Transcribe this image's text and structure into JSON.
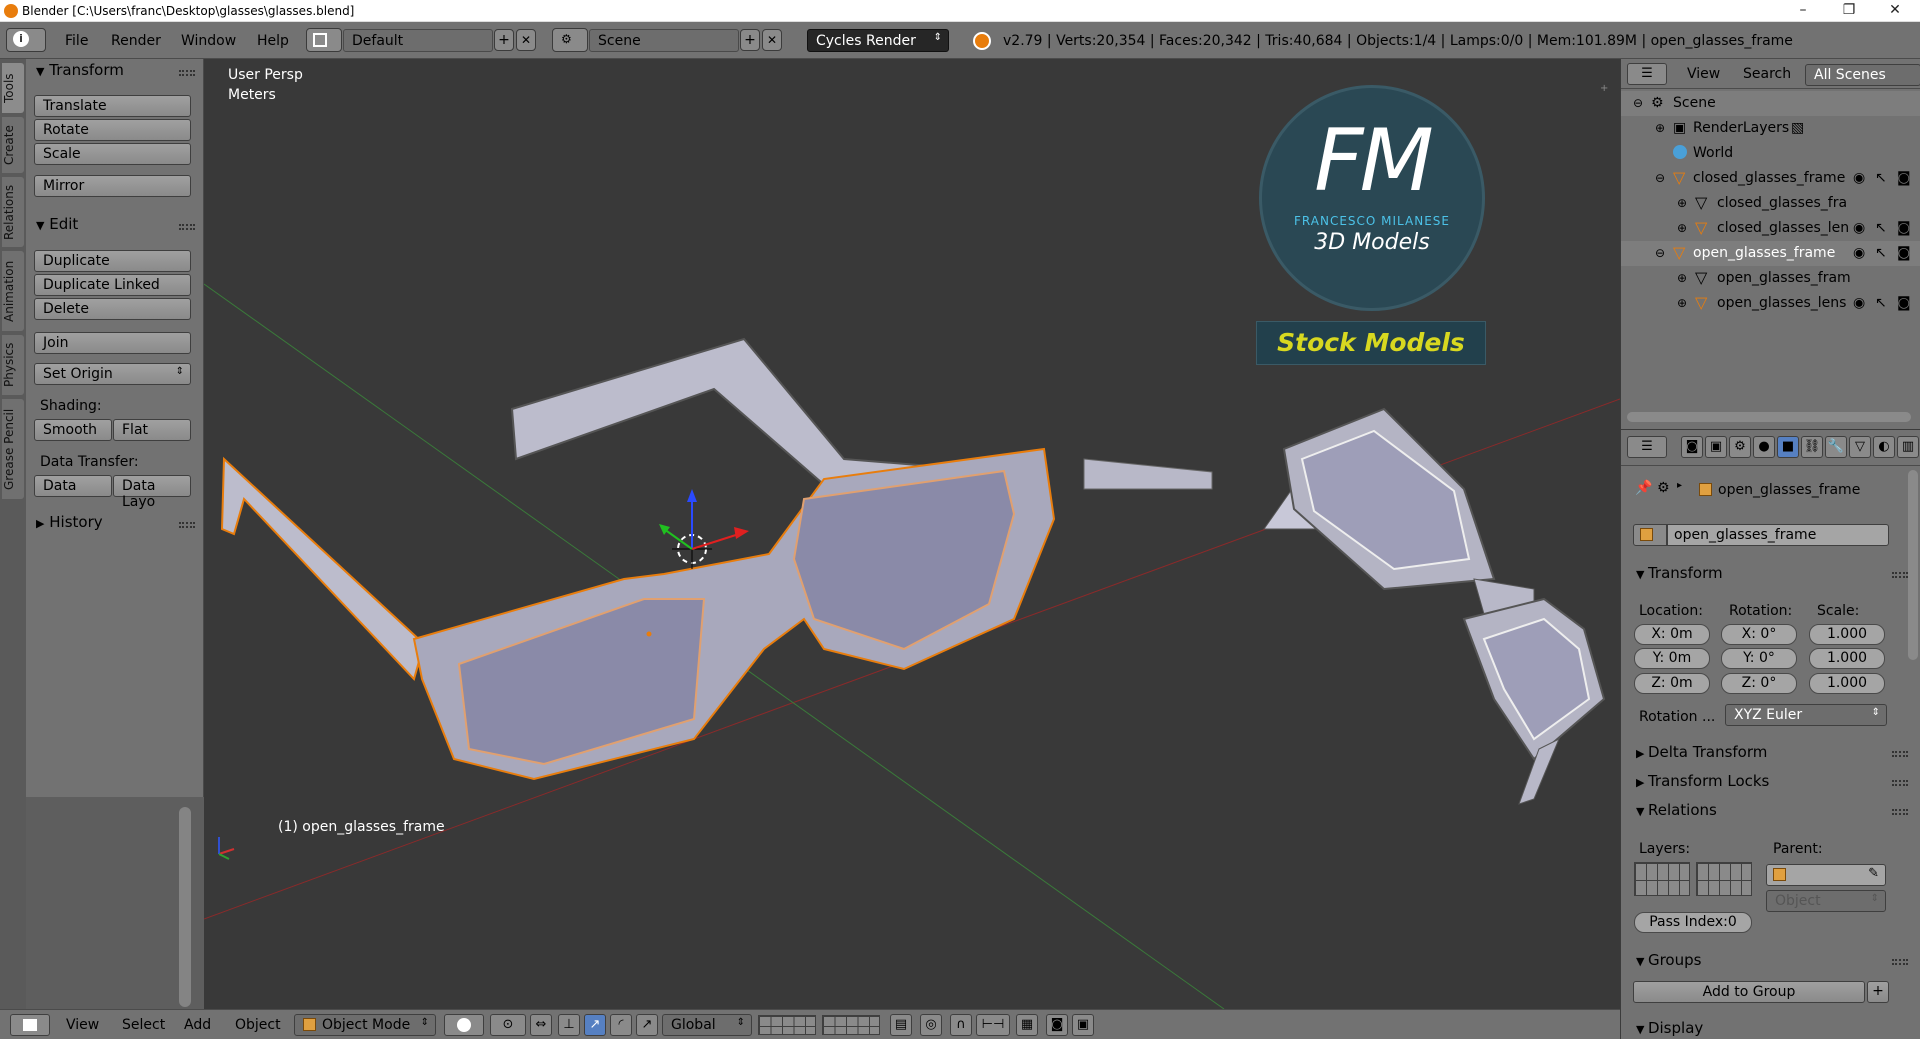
{
  "window": {
    "title": "Blender [C:\\Users\\franc\\Desktop\\glasses\\glasses.blend]",
    "minimize": "–",
    "maximize": "❐",
    "close": "✕"
  },
  "infobar": {
    "menus": [
      "File",
      "Render",
      "Window",
      "Help"
    ],
    "layout": "Default",
    "scene": "Scene",
    "engine": "Cycles Render",
    "stats": "v2.79 | Verts:20,354 | Faces:20,342 | Tris:40,684 | Objects:1/4 | Lamps:0/0 | Mem:101.89M | open_glasses_frame"
  },
  "tabs": [
    "Tools",
    "Create",
    "Relations",
    "Animation",
    "Physics",
    "Grease Pencil"
  ],
  "toolshelf": {
    "transform_title": "Transform",
    "translate": "Translate",
    "rotate": "Rotate",
    "scale": "Scale",
    "mirror": "Mirror",
    "edit_title": "Edit",
    "duplicate": "Duplicate",
    "duplicate_linked": "Duplicate Linked",
    "delete": "Delete",
    "join": "Join",
    "set_origin": "Set Origin",
    "shading_label": "Shading:",
    "smooth": "Smooth",
    "flat": "Flat",
    "data_transfer_label": "Data Transfer:",
    "data": "Data",
    "data_layo": "Data Layo",
    "history_title": "History"
  },
  "viewport": {
    "view_name": "User Persp",
    "units": "Meters",
    "selected_object": "(1) open_glasses_frame",
    "logo": {
      "initials": "FM",
      "name": "FRANCESCO MILANESE",
      "subtitle": "3D Models",
      "badge": "Stock Models"
    }
  },
  "bottombar": {
    "menus": [
      "View",
      "Select",
      "Add",
      "Object"
    ],
    "mode": "Object Mode",
    "orientation": "Global"
  },
  "outliner": {
    "header": {
      "view": "View",
      "search": "Search",
      "filter": "All Scenes"
    },
    "rows": [
      "Scene",
      "RenderLayers",
      "World",
      "closed_glasses_frame",
      "closed_glasses_fra",
      "closed_glasses_len",
      "open_glasses_frame",
      "open_glasses_fram",
      "open_glasses_lens"
    ]
  },
  "properties": {
    "breadcrumb": "open_glasses_frame",
    "object_name": "open_glasses_frame",
    "transform_title": "Transform",
    "location_label": "Location:",
    "rotation_label": "Rotation:",
    "scale_label": "Scale:",
    "loc_x": "X: 0m",
    "loc_y": "Y: 0m",
    "loc_z": "Z: 0m",
    "rot_x": "X:  0°",
    "rot_y": "Y:  0°",
    "rot_z": "Z:  0°",
    "scl_x": "1.000",
    "scl_y": "1.000",
    "scl_z": "1.000",
    "rotation_mode_label": "Rotation ...",
    "rotation_mode": "XYZ Euler",
    "delta_transform": "Delta Transform",
    "transform_locks": "Transform Locks",
    "relations_title": "Relations",
    "layers_label": "Layers:",
    "parent_label": "Parent:",
    "parent_type": "Object",
    "pass_index": "Pass Index:0",
    "groups_title": "Groups",
    "add_to_group": "Add to Group",
    "display_title": "Display"
  },
  "colors": {
    "accent": "#5680c2",
    "selection": "#e87d0d",
    "panel": "#727272",
    "viewport": "#393939"
  }
}
